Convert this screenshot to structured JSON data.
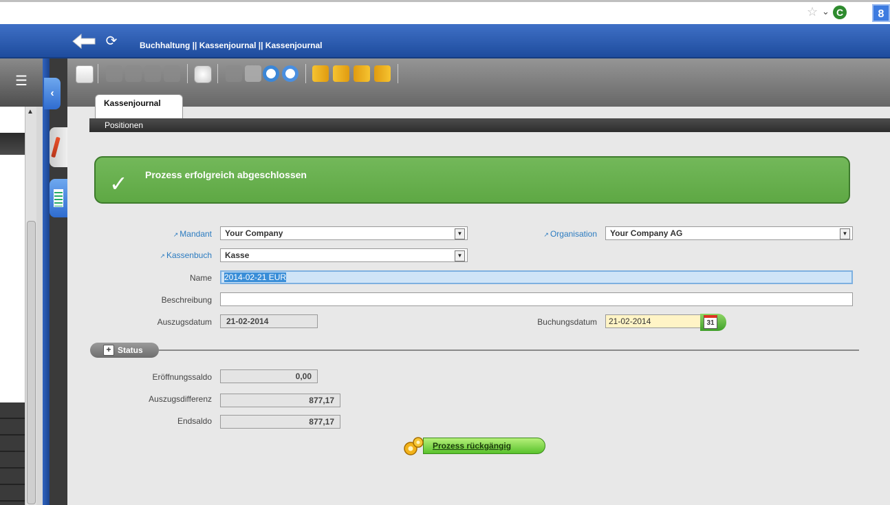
{
  "app": {
    "breadcrumb": "Buchhaltung || Kassenjournal  ||  Kassenjournal"
  },
  "tabs": {
    "main": "Kassenjournal",
    "sub": "Positionen"
  },
  "message": {
    "success": "Prozess erfolgreich abgeschlossen"
  },
  "form": {
    "mandant_label": "Mandant",
    "mandant_value": "Your Company",
    "organisation_label": "Organisation",
    "organisation_value": "Your Company AG",
    "kassenbuch_label": "Kassenbuch",
    "kassenbuch_value": "Kasse",
    "name_label": "Name",
    "name_value": "2014-02-21 EUR",
    "beschreibung_label": "Beschreibung",
    "beschreibung_value": "",
    "auszugsdatum_label": "Auszugsdatum",
    "auszugsdatum_value": "21-02-2014",
    "buchungsdatum_label": "Buchungsdatum",
    "buchungsdatum_value": "21-02-2014",
    "calendar_day": "31"
  },
  "status": {
    "section_label": "Status",
    "eroeffnungssaldo_label": "Eröffnungssaldo",
    "eroeffnungssaldo_value": "0,00",
    "auszugsdifferenz_label": "Auszugsdifferenz",
    "auszugsdifferenz_value": "877,17",
    "endsaldo_label": "Endsaldo",
    "endsaldo_value": "877,17"
  },
  "actions": {
    "process_undo": "Prozess rückgängig"
  },
  "colors": {
    "title_bar": "#2b5cb0",
    "success_bg": "#6ab04f",
    "link_blue": "#2b7bc0"
  }
}
